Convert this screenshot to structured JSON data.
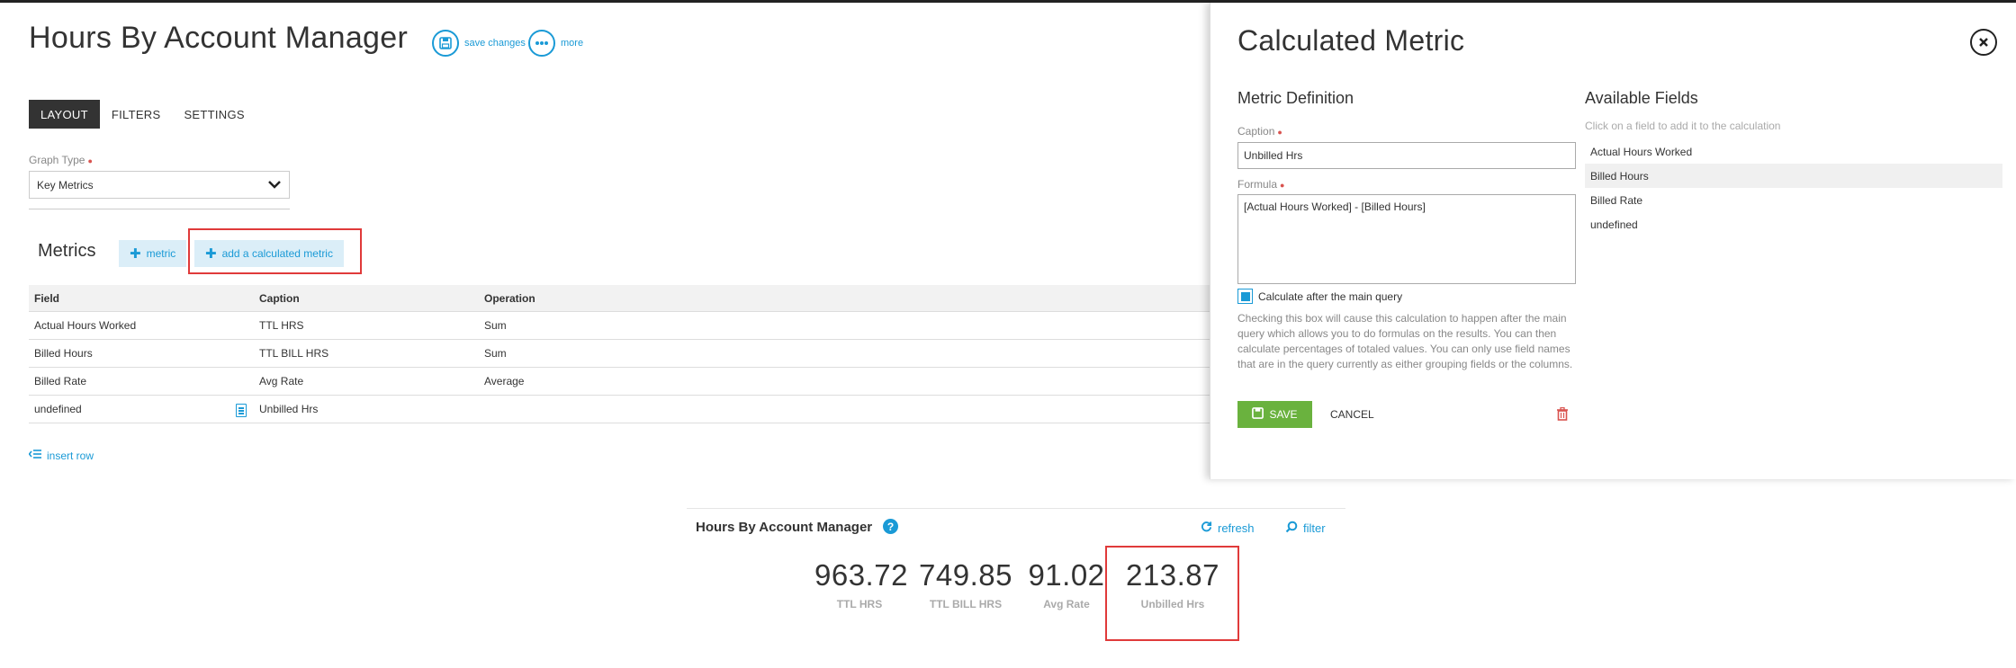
{
  "editor": {
    "title": "Hours By Account Manager",
    "save_changes": "save changes",
    "more": "more",
    "tabs": [
      "LAYOUT",
      "FILTERS",
      "SETTINGS"
    ],
    "graph_type_label": "Graph Type",
    "graph_type_value": "Key Metrics",
    "metrics_title": "Metrics",
    "metric_button": "metric",
    "calc_metric_button": "add a calculated metric",
    "table_headers": [
      "Field",
      "Caption",
      "Operation"
    ],
    "rows": [
      [
        "Actual Hours Worked",
        "TTL HRS",
        "Sum"
      ],
      [
        "Billed Hours",
        "TTL BILL HRS",
        "Sum"
      ],
      [
        "Billed Rate",
        "Avg Rate",
        "Average"
      ],
      [
        "undefined",
        "Unbilled Hrs",
        ""
      ]
    ],
    "insert_row": "insert row"
  },
  "calc_panel": {
    "title": "Calculated Metric",
    "metric_definition": "Metric Definition",
    "caption_label": "Caption",
    "caption_value": "Unbilled Hrs",
    "formula_label": "Formula",
    "formula_value": "[Actual Hours Worked] - [Billed Hours]",
    "checkbox_label": "Calculate after the main query",
    "checkbox_checked": true,
    "help_text": "Checking this box will cause this calculation to happen after the main query which allows you to do formulas on the results. You can then calculate percentages of totaled values. You can only use field names that are in the query currently as either grouping fields or the columns.",
    "save_label": "SAVE",
    "cancel_label": "CANCEL",
    "available_fields_title": "Available Fields",
    "available_fields_hint": "Click on a field to add it to the calculation",
    "fields": [
      "Actual Hours Worked",
      "Billed Hours",
      "Billed Rate",
      "undefined"
    ]
  },
  "widget": {
    "title": "Hours By Account Manager",
    "help": "?",
    "refresh": "refresh",
    "filter": "filter",
    "kpis": [
      {
        "value": "963.72",
        "label": "TTL HRS"
      },
      {
        "value": "749.85",
        "label": "TTL BILL HRS"
      },
      {
        "value": "91.02",
        "label": "Avg Rate"
      },
      {
        "value": "213.87",
        "label": "Unbilled Hrs"
      }
    ]
  },
  "colors": {
    "accent": "#1a9ad6",
    "save": "#6ab23e",
    "highlight": "#e03a3a",
    "required": "#d9534f"
  },
  "icons": [
    "save-icon",
    "more-icon",
    "chevron-down-icon",
    "plus-icon",
    "calculator-icon",
    "insert-row-icon",
    "close-icon",
    "checkbox-icon",
    "trash-icon",
    "help-icon",
    "refresh-icon",
    "search-icon"
  ]
}
